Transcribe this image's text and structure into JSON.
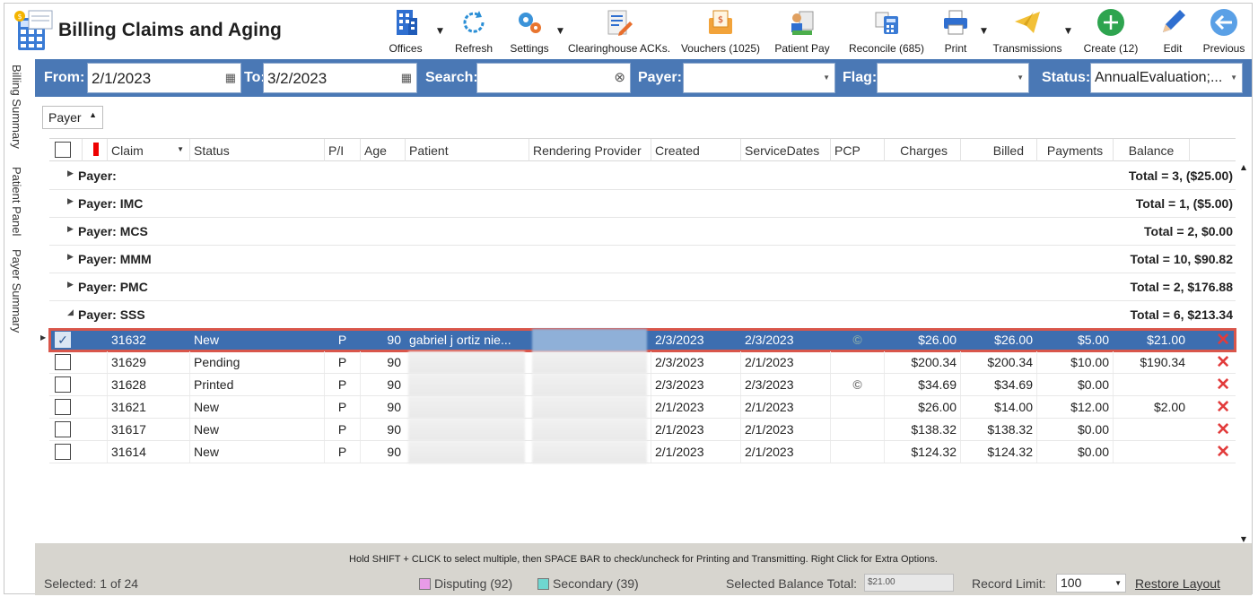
{
  "app": {
    "title": "Billing Claims and Aging"
  },
  "toolbar": [
    {
      "label": "Offices",
      "icon": "offices-icon",
      "caret": true
    },
    {
      "label": "Refresh",
      "icon": "refresh-icon",
      "caret": false
    },
    {
      "label": "Settings",
      "icon": "gear-icon",
      "caret": true
    },
    {
      "label": "Clearinghouse ACKs.",
      "icon": "document-edit-icon",
      "caret": false
    },
    {
      "label": "Vouchers (1025)",
      "icon": "voucher-icon",
      "caret": false
    },
    {
      "label": "Patient Pay",
      "icon": "patient-pay-icon",
      "caret": false
    },
    {
      "label": "Reconcile (685)",
      "icon": "calculator-icon",
      "caret": false
    },
    {
      "label": "Print",
      "icon": "printer-icon",
      "caret": true
    },
    {
      "label": "Transmissions",
      "icon": "paper-plane-icon",
      "caret": true
    },
    {
      "label": "Create (12)",
      "icon": "plus-circle-icon",
      "caret": false
    },
    {
      "label": "Edit",
      "icon": "pencil-icon",
      "caret": false
    },
    {
      "label": "Previous",
      "icon": "back-arrow-icon",
      "caret": false
    }
  ],
  "side_tabs": [
    "Billing Summary",
    "Patient Panel",
    "Payer Summary"
  ],
  "filters": {
    "from_label": "From:",
    "from_value": "2/1/2023",
    "to_label": "To:",
    "to_value": "3/2/2023",
    "search_label": "Search:",
    "search_value": "",
    "payer_label": "Payer:",
    "payer_value": "",
    "flag_label": "Flag:",
    "flag_value": "",
    "status_label": "Status:",
    "status_value": "AnnualEvaluation;..."
  },
  "group_by": "Payer",
  "columns": [
    "Claim",
    "Status",
    "P/I",
    "Age",
    "Patient",
    "Rendering Provider",
    "Created",
    "ServiceDates",
    "PCP",
    "Charges",
    "Billed",
    "Payments",
    "Balance"
  ],
  "groups": [
    {
      "label": "Payer:",
      "total": "Total = 3,  ($25.00)"
    },
    {
      "label": "Payer: IMC",
      "total": "Total = 1,  ($5.00)"
    },
    {
      "label": "Payer: MCS",
      "total": "Total = 2,  $0.00"
    },
    {
      "label": "Payer: MMM",
      "total": "Total = 10,  $90.82"
    },
    {
      "label": "Payer: PMC",
      "total": "Total = 2,  $176.88"
    },
    {
      "label": "Payer: SSS",
      "total": "Total = 6,  $213.34"
    }
  ],
  "rows": [
    {
      "checked": true,
      "claim": "31632",
      "status": "New",
      "pi": "P",
      "age": "90",
      "patient": "gabriel j ortiz nie...",
      "provider": "",
      "created": "2/3/2023",
      "service": "2/3/2023",
      "pcp": "©",
      "charges": "$26.00",
      "billed": "$26.00",
      "payments": "$5.00",
      "balance": "$21.00"
    },
    {
      "checked": false,
      "claim": "31629",
      "status": "Pending",
      "pi": "P",
      "age": "90",
      "patient": "",
      "provider": "",
      "created": "2/3/2023",
      "service": "2/1/2023",
      "pcp": "",
      "charges": "$200.34",
      "billed": "$200.34",
      "payments": "$10.00",
      "balance": "$190.34"
    },
    {
      "checked": false,
      "claim": "31628",
      "status": "Printed",
      "pi": "P",
      "age": "90",
      "patient": "",
      "provider": "",
      "created": "2/3/2023",
      "service": "2/3/2023",
      "pcp": "©",
      "charges": "$34.69",
      "billed": "$34.69",
      "payments": "$0.00",
      "balance": ""
    },
    {
      "checked": false,
      "claim": "31621",
      "status": "New",
      "pi": "P",
      "age": "90",
      "patient": "",
      "provider": "",
      "created": "2/1/2023",
      "service": "2/1/2023",
      "pcp": "",
      "charges": "$26.00",
      "billed": "$14.00",
      "payments": "$12.00",
      "balance": "$2.00"
    },
    {
      "checked": false,
      "claim": "31617",
      "status": "New",
      "pi": "P",
      "age": "90",
      "patient": "",
      "provider": "",
      "created": "2/1/2023",
      "service": "2/1/2023",
      "pcp": "",
      "charges": "$138.32",
      "billed": "$138.32",
      "payments": "$0.00",
      "balance": ""
    },
    {
      "checked": false,
      "claim": "31614",
      "status": "New",
      "pi": "P",
      "age": "90",
      "patient": "",
      "provider": "",
      "created": "2/1/2023",
      "service": "2/1/2023",
      "pcp": "",
      "charges": "$124.32",
      "billed": "$124.32",
      "payments": "$0.00",
      "balance": ""
    }
  ],
  "footer": {
    "hint": "Hold SHIFT + CLICK to select multiple, then SPACE BAR to check/uncheck for Printing and Transmitting. Right Click for Extra Options.",
    "selected": "Selected: 1 of 24",
    "disputing": "Disputing (92)",
    "secondary": "Secondary (39)",
    "balance_label": "Selected Balance Total:",
    "balance_value": "$21.00",
    "limit_label": "Record Limit:",
    "limit_value": "100",
    "restore": "Restore Layout"
  },
  "colors": {
    "accent": "#4a78b5",
    "selection": "#3d6eb0",
    "selection_outline": "#d9564b",
    "disputing": "#e89be8",
    "secondary": "#6fd6d0",
    "delete": "#e23b3b"
  }
}
